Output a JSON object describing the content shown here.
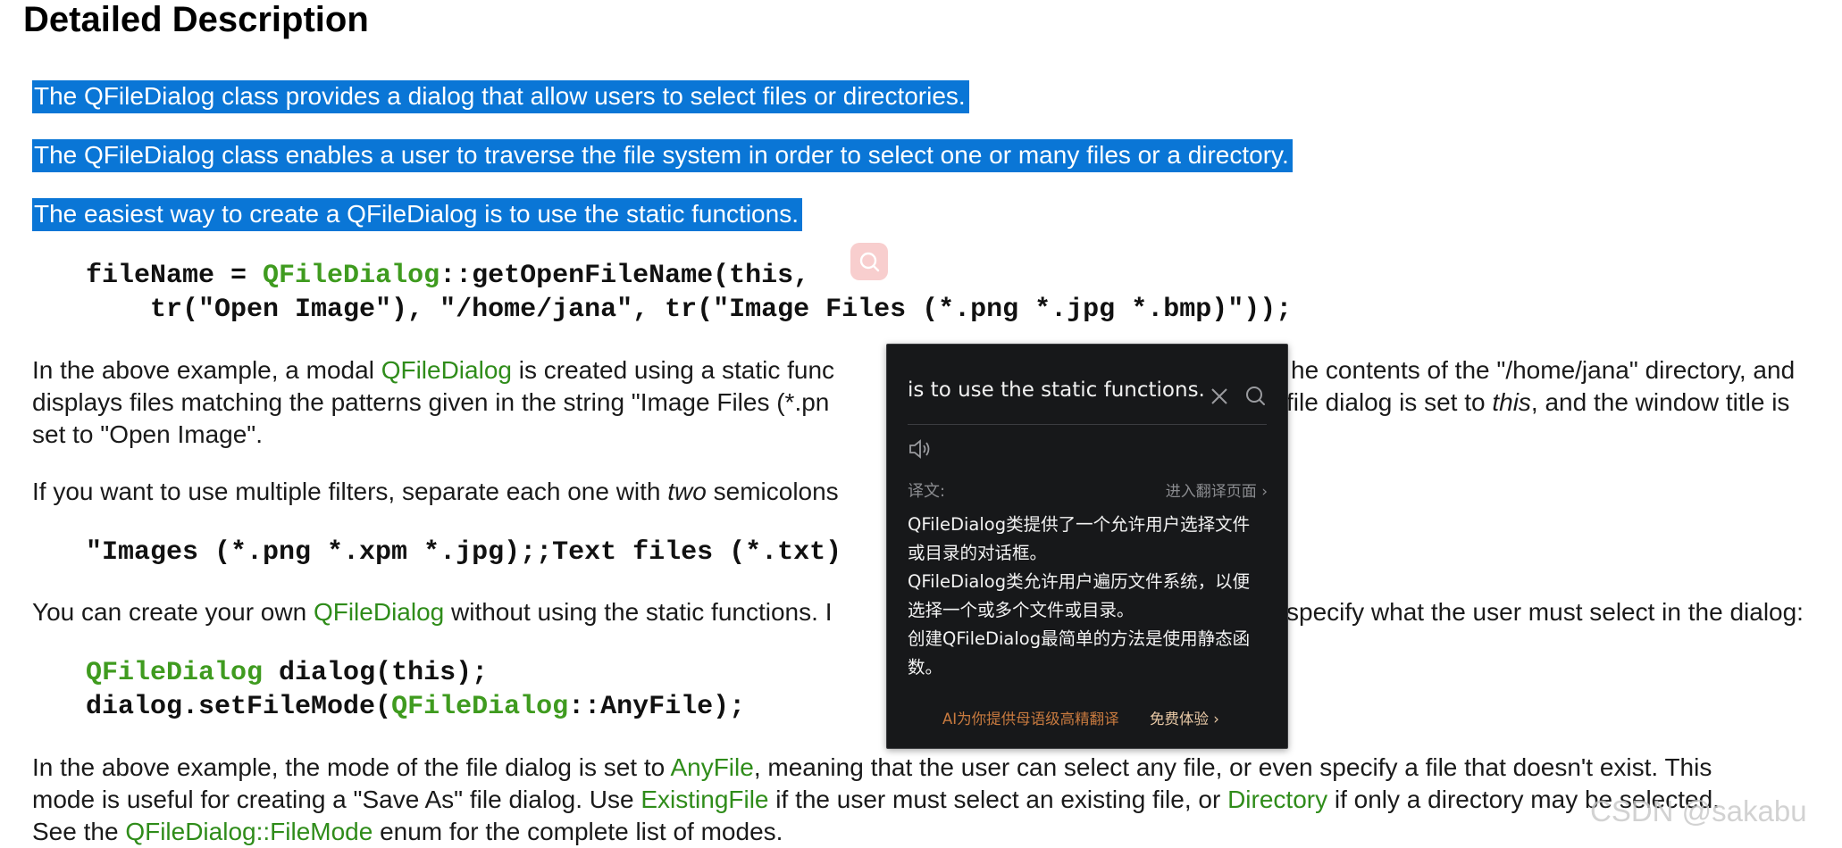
{
  "heading": "Detailed Description",
  "selected_lines": [
    "The QFileDialog class provides a dialog that allow users to select files or directories.",
    "The QFileDialog class enables a user to traverse the file system in order to select one or many files or a directory.",
    "The easiest way to create a QFileDialog is to use the static functions."
  ],
  "code1": {
    "l1_a": "fileName = ",
    "l1_cls": "QFileDialog",
    "l1_b": "::getOpenFileName(this,",
    "l2": "    tr(\"Open Image\"), \"/home/jana\", tr(\"Image Files (*.png *.jpg *.bmp)\"));"
  },
  "para1": {
    "l1_a": "In the above example, a modal ",
    "l1_link": "QFileDialog",
    "l1_b": " is created using a static func",
    "l1_c": "he contents of the \"/home/jana\" directory, and",
    "l2_a": "displays files matching the patterns given in the string \"Image Files (*.pn",
    "l2_b": "file dialog is set to ",
    "l2_italic": "this",
    "l2_c": ", and the window title is",
    "l3": "set to \"Open Image\"."
  },
  "para2": {
    "a": "If you want to use multiple filters, separate each one with ",
    "italic": "two",
    "b": " semicolons"
  },
  "code2": "\"Images (*.png *.xpm *.jpg);;Text files (*.txt)",
  "para3": {
    "a": "You can create your own ",
    "link": "QFileDialog",
    "b": " without using the static functions. I",
    "c": "specify what the user must select in the dialog:"
  },
  "code3": {
    "l1_cls": "QFileDialog",
    "l1_b": " dialog(this);",
    "l2_a": "dialog.setFileMode(",
    "l2_cls": "QFileDialog",
    "l2_b": "::AnyFile);"
  },
  "para4": {
    "l1_a": "In the above example, the mode of the file dialog is set to ",
    "l1_link": "AnyFile",
    "l1_b": ", meaning that the user can select any file, or even specify a file that doesn't exist. This",
    "l2_a": "mode is useful for creating a \"Save As\" file dialog. Use ",
    "l2_link1": "ExistingFile",
    "l2_b": " if the user must select an existing file, or ",
    "l2_link2": "Directory",
    "l2_c": " if only a directory may be selected.",
    "l3_a": "See the ",
    "l3_link": "QFileDialog::FileMode",
    "l3_b": " enum for the complete list of modes."
  },
  "popup": {
    "source_text": "is to use the static functions.",
    "translation_label": "译文:",
    "translation_page_link": "进入翻译页面 ›",
    "translation_lines": [
      "QFileDialog类提供了一个允许用户选择文件",
      "或目录的对话框。",
      "QFileDialog类允许用户遍历文件系统，以便",
      "选择一个或多个文件或目录。",
      "创建QFileDialog最简单的方法是使用静态函",
      "数。"
    ],
    "ai_note": "AI为你提供母语级高精翻译",
    "free_trial": "免费体验 ›"
  },
  "watermark": "CSDN @sakabu",
  "colors": {
    "selection": "#0a76d6",
    "code_class": "#3f9b1f",
    "link": "#2f8c1a",
    "popup_bg": "#17181a"
  },
  "icons": [
    "search-icon",
    "close-icon",
    "speaker-icon"
  ]
}
